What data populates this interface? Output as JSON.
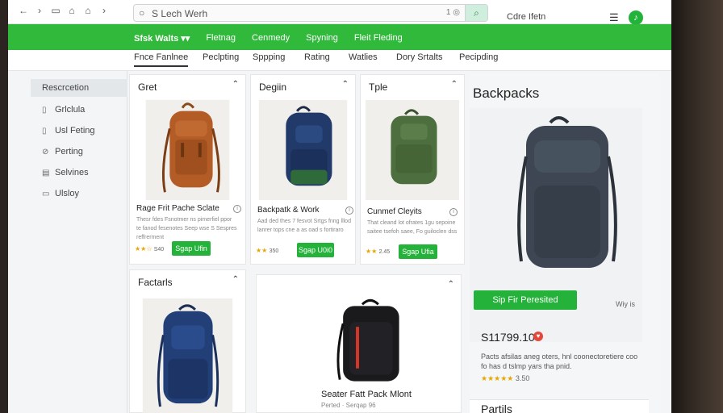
{
  "browser": {
    "url": "S Lech Werh",
    "extra": "1 ◎",
    "user_name": "Cdre Ifetn"
  },
  "green_nav": {
    "items": [
      "Sfsk Walts ▾▾",
      "Fletnag",
      "Cenmedy",
      "Spyning",
      "Fleit Fleding"
    ]
  },
  "tabs": [
    "Fnce Fanlnee",
    "Peclpting",
    "Sppping",
    "Rating",
    "Watlies",
    "Dory Srtalts",
    "Pecipding"
  ],
  "sidebar": {
    "items": [
      {
        "label": "Rescrcetion",
        "icon": ""
      },
      {
        "label": "Grlclula",
        "icon": "▯"
      },
      {
        "label": "Usl Feting",
        "icon": "▯"
      },
      {
        "label": "Perting",
        "icon": "⊘"
      },
      {
        "label": "Selvines",
        "icon": "▤"
      },
      {
        "label": "Ulsloy",
        "icon": "▭"
      }
    ]
  },
  "cards": [
    {
      "title": "Gret",
      "product": "Rage Frit Pache Sclate",
      "desc": "Thesr fdes Fsnotmer ns pimerfiel ppor te fanod fesenotes Seep wse S Sespres reffrerment",
      "rating_stars": "★★☆",
      "rating_num": "S40",
      "button": "Sgap Ufin"
    },
    {
      "title": "Degiin",
      "product": "Backpatk & Work",
      "desc": "Aad ded thes 7 fesvot Srtgs fnng lllod lanrer tops cne a as oad s fortiraro",
      "rating_stars": "★★",
      "rating_num": "350",
      "button": "Sgap U0i0"
    },
    {
      "title": "Tple",
      "product": "Cunmef Cleyits",
      "desc": "That cleand lot ofrates 1gu sepoine saitee tsefoh saee, Fo guiloclen dss",
      "rating_stars": "★★",
      "rating_num": "2.45",
      "button": "Sgap Ufia"
    },
    {
      "title": "Factarls",
      "product": "",
      "desc": ""
    },
    {
      "title": "",
      "product": "Seater Fatt Pack Mlont",
      "desc": "Perted · Serqap 96"
    }
  ],
  "right_panel": {
    "title": "Backpacks",
    "button": "Sip Fir Peresited",
    "why": "Wiy is",
    "price": "S11799.10",
    "desc": "Pacts afsilas aneg oters, hnl coonectoretiere coo fo has d tslmp yars tha pnid.",
    "rating_stars": "★★★★★",
    "rating_num": "3.50",
    "sub_title": "Partils"
  },
  "colors": {
    "accent_green": "#31b93b",
    "button_green": "#24b23a",
    "star": "#e8a600"
  }
}
